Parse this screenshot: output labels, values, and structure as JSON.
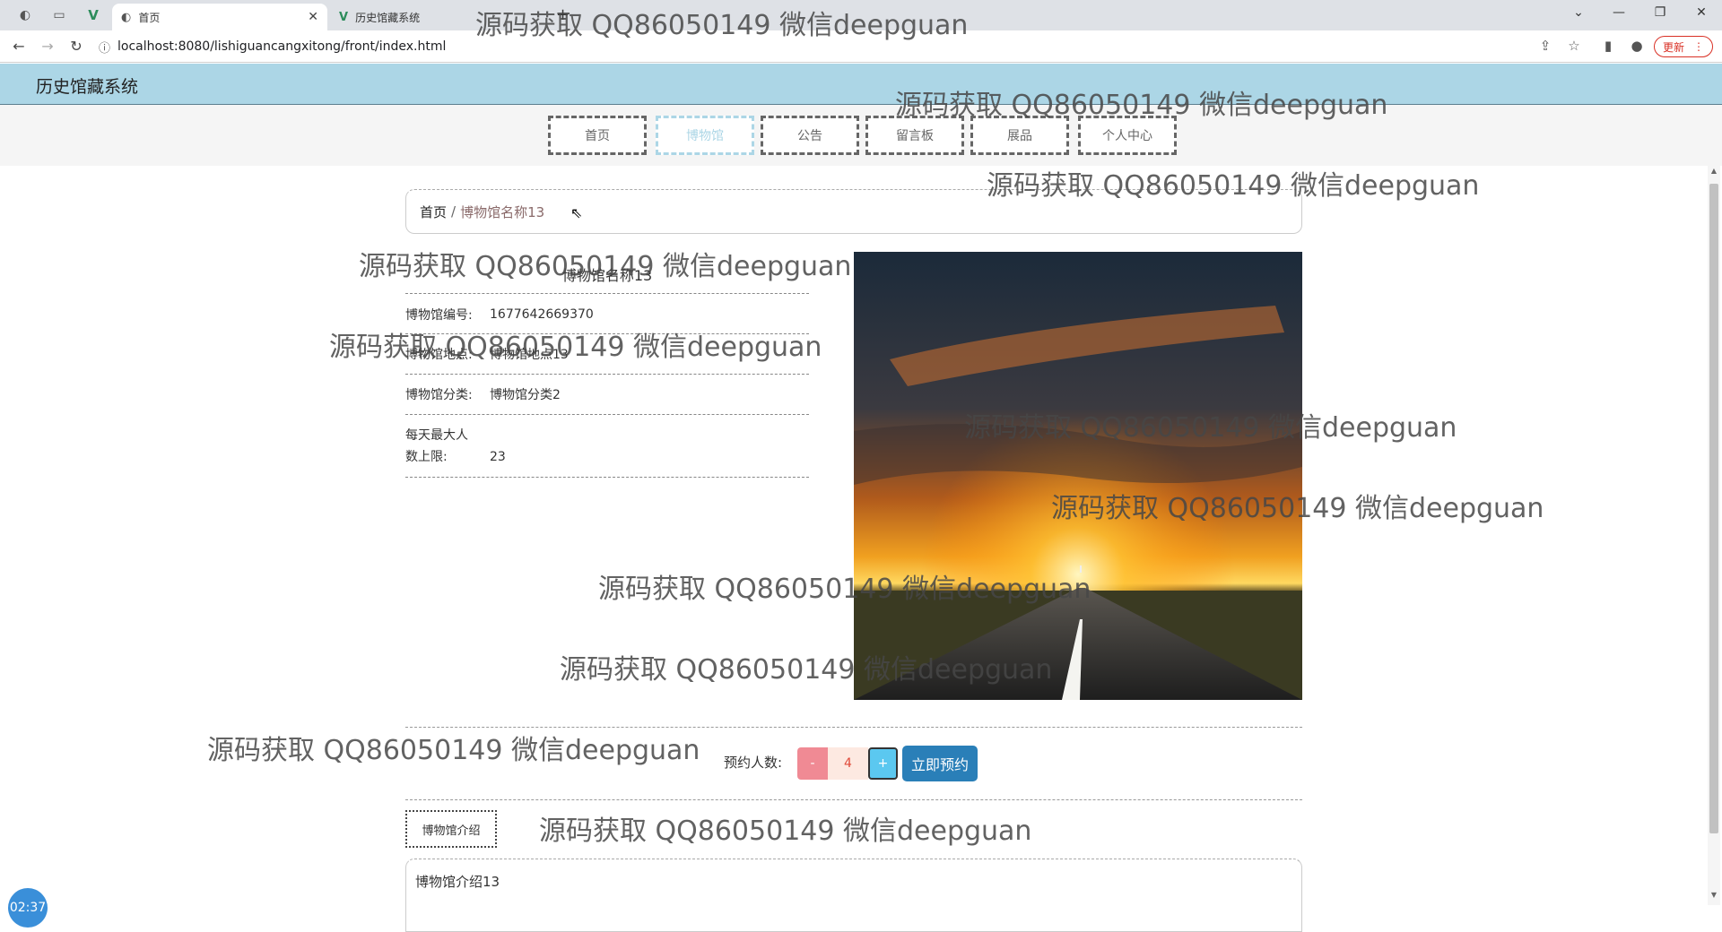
{
  "browser": {
    "tabs": [
      {
        "title": "首页",
        "active": true
      },
      {
        "title": "历史馆藏系统",
        "active": false
      }
    ],
    "url": "localhost:8080/lishiguancangxitong/front/index.html",
    "update_label": "更新"
  },
  "app": {
    "title": "历史馆藏系统",
    "menu": [
      "首页",
      "博物馆",
      "公告",
      "留言板",
      "展品",
      "个人中心"
    ],
    "active_menu": "博物馆"
  },
  "breadcrumb": {
    "home": "首页",
    "separator": "/",
    "current": "博物馆名称13"
  },
  "museum": {
    "name": "博物馆名称13",
    "fields": [
      {
        "label": "博物馆编号:",
        "value": "1677642669370"
      },
      {
        "label": "博物馆地点:",
        "value": "博物馆地点13"
      },
      {
        "label": "博物馆分类:",
        "value": "博物馆分类2"
      },
      {
        "label_line1": "每天最大人",
        "label_line2": "数上限:",
        "value": "23"
      }
    ]
  },
  "booking": {
    "label": "预约人数:",
    "minus": "-",
    "quantity": "4",
    "plus": "+",
    "submit": "立即预约"
  },
  "intro": {
    "tab_label": "博物馆介绍",
    "content": "博物馆介绍13"
  },
  "clock": "02:37",
  "watermark": "源码获取 QQ86050149 微信deepguan",
  "colors": {
    "header_bg": "#acd6e6",
    "menu_active": "#acd6e6",
    "minus_btn": "#f08a94",
    "plus_btn": "#5bc8f0",
    "reserve_btn": "#2a7fb8"
  }
}
